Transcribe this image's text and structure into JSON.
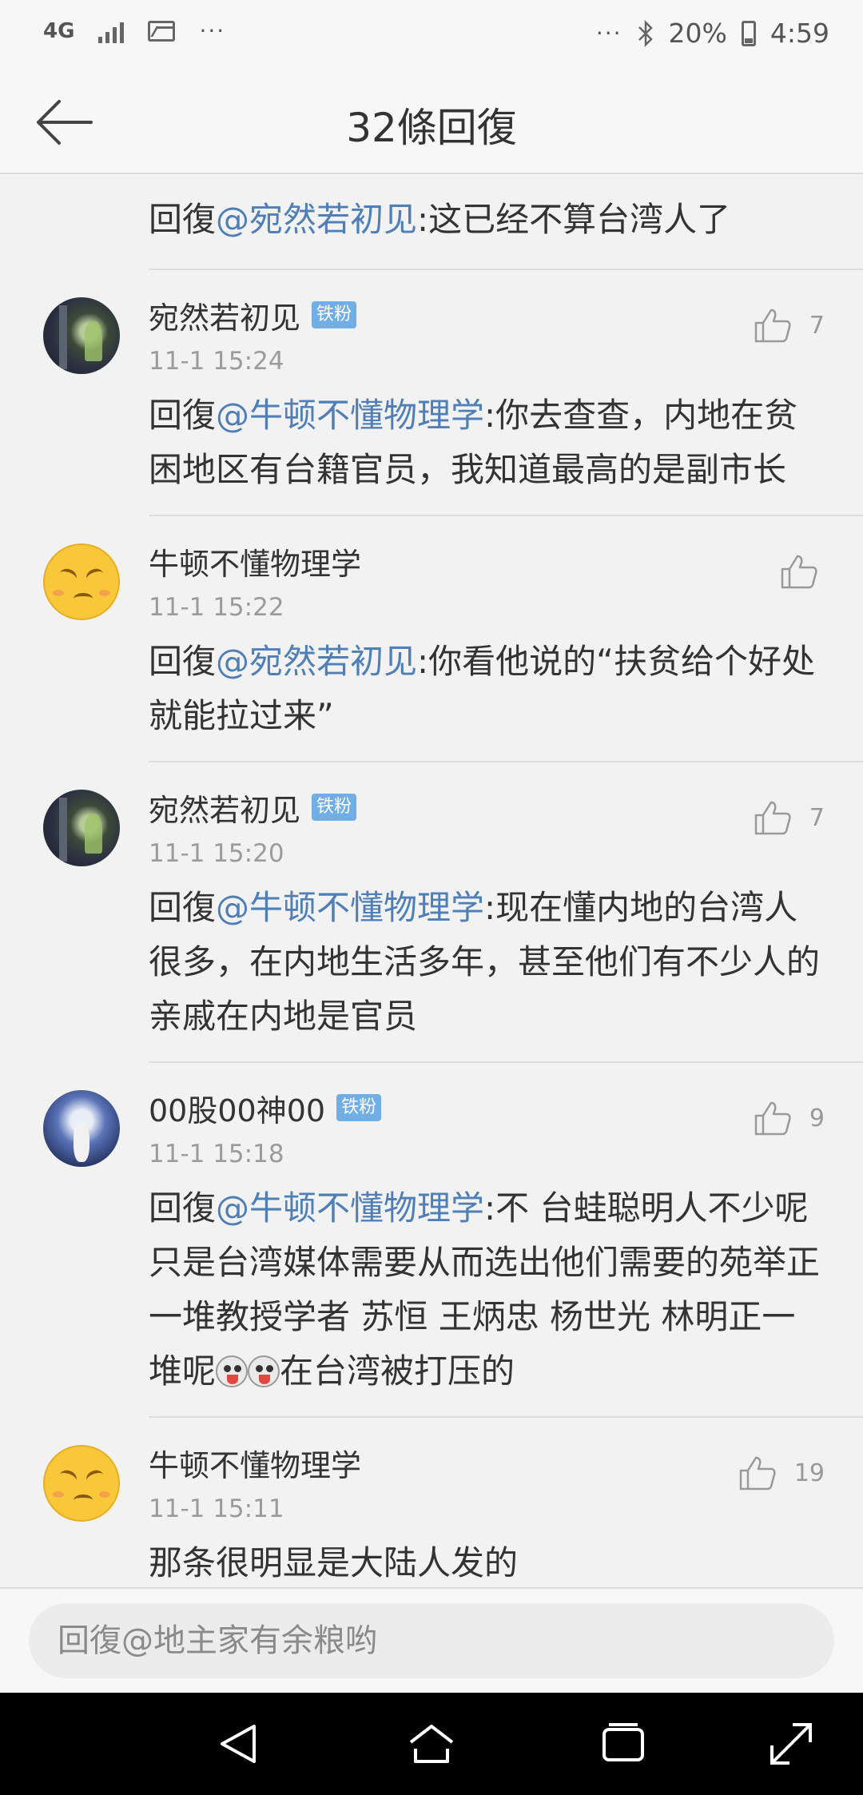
{
  "status_bar": {
    "network": "4G",
    "more": "···",
    "more_right": "···",
    "battery": "20%",
    "time": "4:59"
  },
  "header": {
    "title": "32條回復"
  },
  "first_reply": {
    "prefix": "回復",
    "mention": "@宛然若初见",
    "text": ":这已经不算台湾人了"
  },
  "comments": [
    {
      "name": "宛然若初见",
      "badge": "铁粉",
      "time": "11-1 15:24",
      "likes": "7",
      "prefix": "回復",
      "mention": "@牛顿不懂物理学",
      "text": ":你去查查，内地在贫困地区有台籍官员，我知道最高的是副市长"
    },
    {
      "name": "牛顿不懂物理学",
      "badge": "",
      "time": "11-1 15:22",
      "likes": "",
      "prefix": "回復",
      "mention": "@宛然若初见",
      "text": ":你看他说的“扶贫给个好处就能拉过来”"
    },
    {
      "name": "宛然若初见",
      "badge": "铁粉",
      "time": "11-1 15:20",
      "likes": "7",
      "prefix": "回復",
      "mention": "@牛顿不懂物理学",
      "text": ":现在懂内地的台湾人很多，在内地生活多年，甚至他们有不少人的亲戚在内地是官员"
    },
    {
      "name": "00股00神00",
      "badge": "铁粉",
      "time": "11-1 15:18",
      "likes": "9",
      "prefix": "回復",
      "mention": "@牛顿不懂物理学",
      "text": ":不  台蛙聪明人不少呢只是台湾媒体需要从而选出他们需要的苑举正一堆教授学者  苏恒 王炳忠  杨世光 林明正一堆呢",
      "text_after": "在台湾被打压的"
    },
    {
      "name": "牛顿不懂物理学",
      "badge": "",
      "time": "11-1 15:11",
      "likes": "19",
      "text": "那条很明显是大陆人发的"
    }
  ],
  "input": {
    "placeholder": "回復@地主家有余粮哟"
  }
}
